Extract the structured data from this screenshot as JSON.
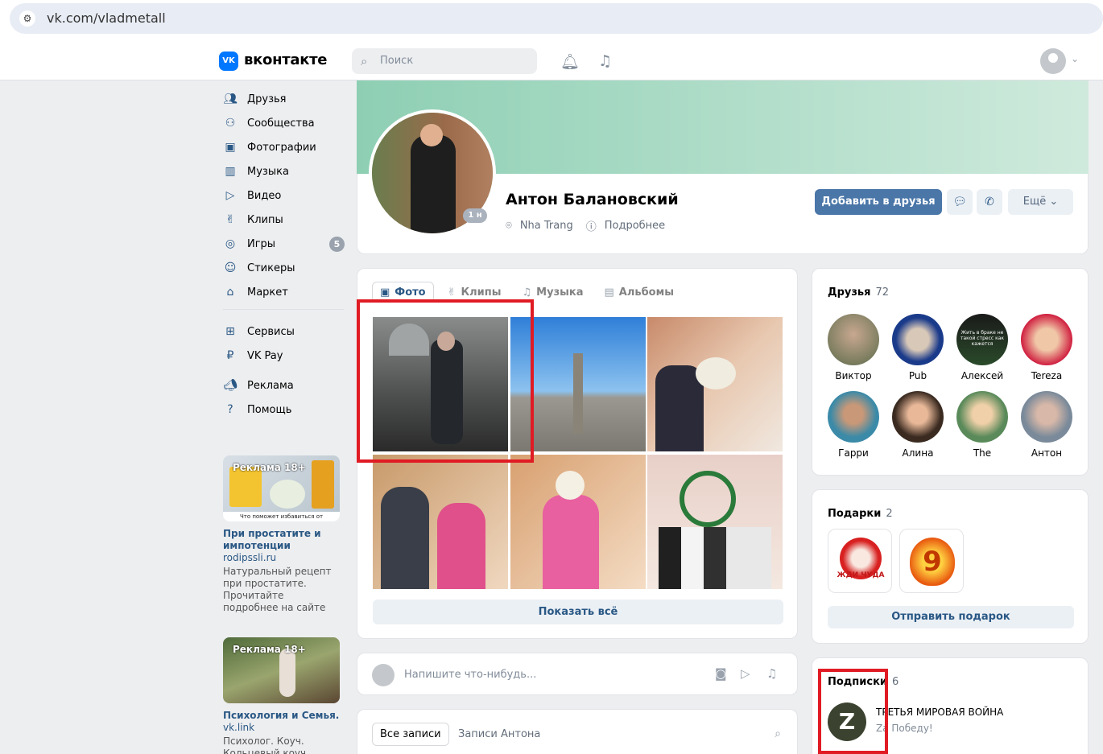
{
  "browser": {
    "url": "vk.com/vladmetall"
  },
  "header": {
    "logo_mark": "VK",
    "logo_text": "вконтакте",
    "search_placeholder": "Поиск"
  },
  "sidebar": {
    "items": [
      {
        "label": "Друзья",
        "icon": "friends-icon"
      },
      {
        "label": "Сообщества",
        "icon": "communities-icon"
      },
      {
        "label": "Фотографии",
        "icon": "photos-icon"
      },
      {
        "label": "Музыка",
        "icon": "music-icon"
      },
      {
        "label": "Видео",
        "icon": "video-icon"
      },
      {
        "label": "Клипы",
        "icon": "clips-icon"
      },
      {
        "label": "Игры",
        "icon": "games-icon",
        "badge": "5"
      },
      {
        "label": "Стикеры",
        "icon": "stickers-icon"
      },
      {
        "label": "Маркет",
        "icon": "market-icon"
      },
      {
        "label": "Сервисы",
        "icon": "services-icon"
      },
      {
        "label": "VK Pay",
        "icon": "vkpay-icon"
      },
      {
        "label": "Реклама",
        "icon": "ads-icon"
      },
      {
        "label": "Помощь",
        "icon": "help-icon"
      }
    ]
  },
  "ads": [
    {
      "tag": "Реклама 18+",
      "banner_text": "Что поможет избавиться от простатита?",
      "title": "При простатите и импотенции",
      "link": "rodipssli.ru",
      "desc": "Натуральный рецепт при простатите. Прочитайте подробнее на сайте"
    },
    {
      "tag": "Реклама 18+",
      "title": "Психология и Семья.",
      "link": "vk.link",
      "desc": "Психолог. Коуч. Кольцевый коуч"
    }
  ],
  "profile": {
    "name": "Антон Балановский",
    "online_badge": "1 н",
    "location": "Nha Trang",
    "more_info": "Подробнее",
    "add_friend": "Добавить в друзья",
    "more": "Ещё"
  },
  "media": {
    "tabs": [
      {
        "label": "Фото",
        "icon": "photo-tab-icon"
      },
      {
        "label": "Клипы",
        "icon": "clips-tab-icon"
      },
      {
        "label": "Музыка",
        "icon": "music-tab-icon"
      },
      {
        "label": "Альбомы",
        "icon": "albums-tab-icon"
      }
    ],
    "show_all": "Показать всё"
  },
  "compose": {
    "placeholder": "Напишите что-нибудь..."
  },
  "posts": {
    "all": "Все записи",
    "own": "Записи Антона"
  },
  "friends": {
    "title": "Друзья",
    "count": "72",
    "list": [
      "Виктор",
      "Pub",
      "Алексей",
      "Tereza",
      "Гарри",
      "Алина",
      "The",
      "Антон"
    ],
    "overlay_text": "Жить в браке не такой стресс как кажется"
  },
  "gifts": {
    "title": "Подарки",
    "count": "2",
    "gift1_text": "ЖДИ ЧУДА",
    "gift2_text": "9",
    "send": "Отправить подарок"
  },
  "subs": {
    "title": "Подписки",
    "count": "6",
    "avatar_letter": "Z",
    "name": "ТРЕТЬЯ МИРОВАЯ ВОЙНА",
    "desc": "Za Победу!"
  },
  "colors": {
    "accent": "#4a76a8",
    "link": "#2a5885",
    "highlight": "#e01b24",
    "vk_blue": "#0077ff"
  }
}
